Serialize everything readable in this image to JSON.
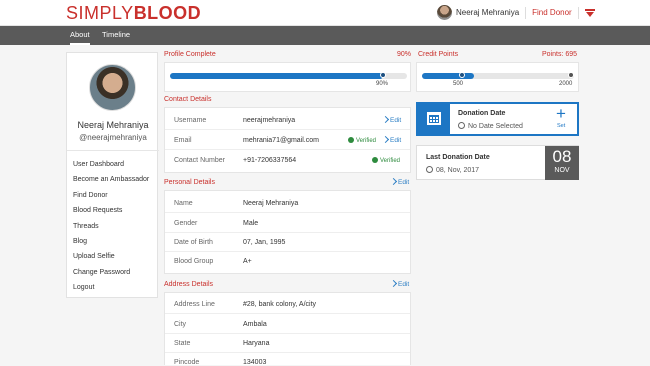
{
  "header": {
    "logo_thin": "SIMPLY",
    "logo_bold": "BLOOD",
    "user_name": "Neeraj Mehraniya",
    "find_donor": "Find Donor"
  },
  "nav": {
    "tabs": [
      "About",
      "Timeline"
    ]
  },
  "profile": {
    "name": "Neeraj Mehraniya",
    "handle": "@neerajmehraniya",
    "menu": [
      "User Dashboard",
      "Become an Ambassador",
      "Find Donor",
      "Blood Requests",
      "Threads",
      "Blog",
      "Upload Selfie",
      "Change Password",
      "Logout"
    ]
  },
  "profile_complete": {
    "title": "Profile Complete",
    "percent_label": "90%",
    "value": 0.9,
    "tick": "90%"
  },
  "credit": {
    "title": "Credit Points",
    "points_label": "Points: 695",
    "value": 695,
    "milestones": [
      "500",
      "2000"
    ]
  },
  "contact": {
    "title": "Contact Details",
    "rows": [
      {
        "label": "Username",
        "value": "neerajmehraniya",
        "verified": "",
        "edit": "Edit"
      },
      {
        "label": "Email",
        "value": "mehrania71@gmail.com",
        "verified": "Verified",
        "edit": "Edit"
      },
      {
        "label": "Contact Number",
        "value": "+91-7206337564",
        "verified": "Verified",
        "edit": ""
      }
    ]
  },
  "personal": {
    "title": "Personal Details",
    "edit": "Edit",
    "rows": [
      {
        "label": "Name",
        "value": "Neeraj Mehraniya"
      },
      {
        "label": "Gender",
        "value": "Male"
      },
      {
        "label": "Date of Birth",
        "value": "07, Jan, 1995"
      },
      {
        "label": "Blood Group",
        "value": "A+"
      }
    ]
  },
  "address": {
    "title": "Address Details",
    "edit": "Edit",
    "rows": [
      {
        "label": "Address Line",
        "value": "#28, bank colony, A/city"
      },
      {
        "label": "City",
        "value": "Ambala"
      },
      {
        "label": "State",
        "value": "Haryana"
      },
      {
        "label": "Pincode",
        "value": "134003"
      }
    ]
  },
  "donation_date": {
    "title": "Donation Date",
    "status": "No Date Selected",
    "set_label": "Set",
    "plus": "+"
  },
  "last_donation": {
    "title": "Last Donation Date",
    "date": "08, Nov, 2017",
    "day": "08",
    "month": "NOV"
  },
  "colors": {
    "brand": "#c9302c",
    "accent": "#1d76c4",
    "verified": "#2e8b3e"
  }
}
